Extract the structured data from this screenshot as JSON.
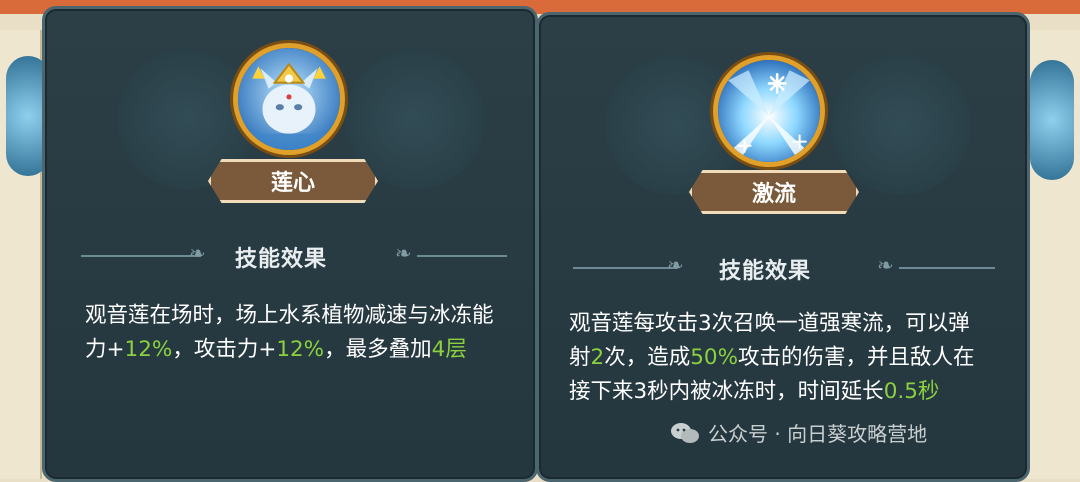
{
  "left_card": {
    "skill_name": "莲心",
    "section_title": "技能效果",
    "desc_part1": "观音莲在场时，场上水系植物减速与冰冻能力+",
    "desc_val1": "12%",
    "desc_part2": "，攻击力+",
    "desc_val2": "12%",
    "desc_part3": "，最多叠加",
    "desc_val3": "4层",
    "icon": "lotus-spirit-icon"
  },
  "right_card": {
    "skill_name": "激流",
    "section_title": "技能效果",
    "desc_part1": "观音莲每攻击3次召唤一道强寒流，可以弹射",
    "desc_val1": "2",
    "desc_part2": "次，造成",
    "desc_val2": "50%",
    "desc_part3": "攻击的伤害，并且敌人在接下来3秒内被冰冻时，时间延长",
    "desc_val3": "0.5秒",
    "icon": "ice-torrent-icon"
  },
  "watermark": {
    "text": "公众号 · 向日葵攻略营地",
    "icon": "wechat-icon"
  },
  "colors": {
    "panel_bg": "#2c3f47",
    "highlight_green": "#8bd13f",
    "plate_brown": "#7a5a3a",
    "icon_gold": "#e0a02a"
  }
}
